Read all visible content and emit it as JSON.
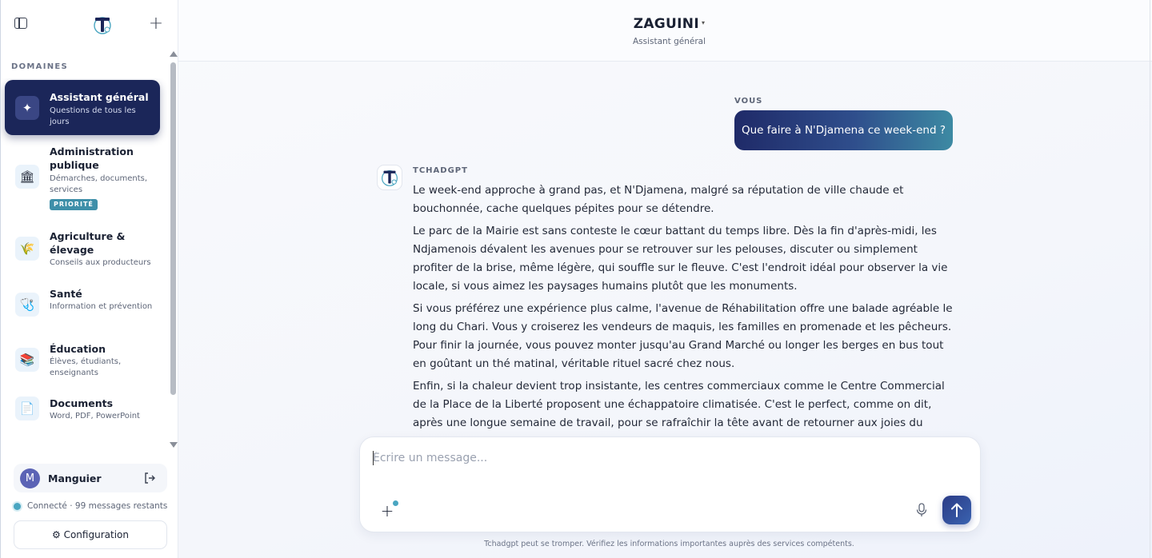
{
  "sidebar": {
    "section_title": "DOMAINES",
    "items": [
      {
        "title": "Assistant général",
        "subtitle": "Questions de tous les jours",
        "icon": "sparkle-icon",
        "glyph": "✦",
        "active": true
      },
      {
        "title": "Administration publique",
        "subtitle": "Démarches, documents, services",
        "icon": "building-icon",
        "glyph": "🏛",
        "badge": "PRIORITÉ"
      },
      {
        "title": "Agriculture & élevage",
        "subtitle": "Conseils aux producteurs",
        "icon": "wheat-icon",
        "glyph": "🌾"
      },
      {
        "title": "Santé",
        "subtitle": "Information et prévention",
        "icon": "stethoscope-icon",
        "glyph": "🩺"
      },
      {
        "title": "Éducation",
        "subtitle": "Élèves, étudiants, enseignants",
        "icon": "books-icon",
        "glyph": "📚"
      },
      {
        "title": "Documents",
        "subtitle": "Word, PDF, PowerPoint",
        "icon": "document-icon",
        "glyph": "📄"
      }
    ],
    "user": {
      "initial": "M",
      "name": "Manguier"
    },
    "status": "Connecté · 99 messages restants",
    "config_label": "⚙ Configuration"
  },
  "header": {
    "title": "ZAGUINI",
    "caret": "▾",
    "subtitle": "Assistant général"
  },
  "chat": {
    "user_label": "VOUS",
    "user_message": "Que faire à N'Djamena ce week-end ?",
    "bot_label": "TCHADGPT",
    "bot_paragraphs": [
      "Le week-end approche à grand pas, et N'Djamena, malgré sa réputation de ville chaude et bouchonnée, cache quelques pépites pour se détendre.",
      "Le parc de la Mairie est sans conteste le cœur battant du temps libre. Dès la fin d'après-midi, les Ndjamenois dévalent les avenues pour se retrouver sur les pelouses, discuter ou simplement profiter de la brise, même légère, qui souffle sur le fleuve. C'est l'endroit idéal pour observer la vie locale, si vous aimez les paysages humains plutôt que les monuments.",
      "Si vous préférez une expérience plus calme, l'avenue de Réhabilitation offre une balade agréable le long du Chari. Vous y croiserez les vendeurs de maquis, les familles en promenade et les pêcheurs. Pour finir la journée, vous pouvez monter jusqu'au Grand Marché ou longer les berges en bus tout en goûtant un thé matinal, véritable rituel sacré chez nous.",
      "Enfin, si la chaleur devient trop insistante, les centres commerciaux comme le Centre Commercial de la Place de la Liberté proposent une échappatoire climatisée. C'est le perfect, comme on dit, après une longue semaine de travail, pour se rafraîchir la tête avant de retourner aux joies du quotidien ndjamenois."
    ]
  },
  "composer": {
    "placeholder": "Écrire un message...",
    "value": "",
    "attach_glyph": "+"
  },
  "disclaimer": "Tchadgpt peut se tromper. Vérifiez les informations importantes auprès des services compétents.",
  "colors": {
    "active_item_bg": "#1b2659",
    "accent": "#3e8fa9",
    "send_button": "#2b3b86"
  }
}
